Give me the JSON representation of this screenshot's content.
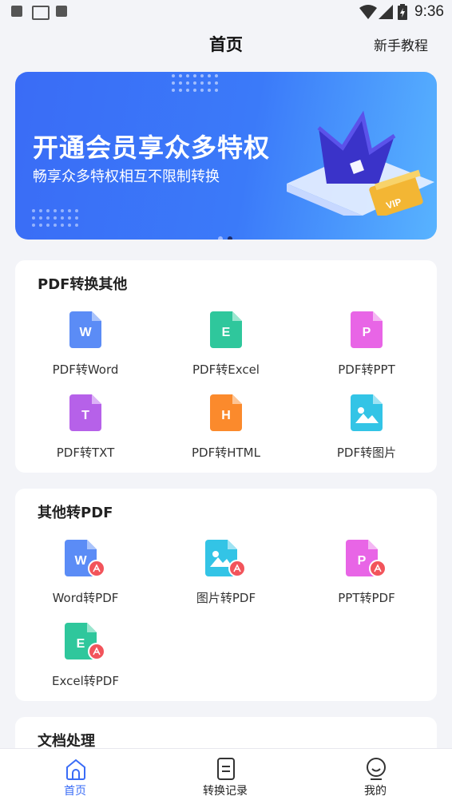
{
  "status_bar": {
    "time": "9:36"
  },
  "header": {
    "title": "首页",
    "tutorial_label": "新手教程"
  },
  "banner": {
    "title": "开通会员享众多特权",
    "subtitle": "畅享众多特权相互不限制转换",
    "badge": "VIP"
  },
  "sections": [
    {
      "title": "PDF转换其他",
      "items": [
        {
          "label": "PDF转Word",
          "glyph": "W",
          "color": "#5b8cf6"
        },
        {
          "label": "PDF转Excel",
          "glyph": "E",
          "color": "#2fc79c"
        },
        {
          "label": "PDF转PPT",
          "glyph": "P",
          "color": "#e865e6"
        },
        {
          "label": "PDF转TXT",
          "glyph": "T",
          "color": "#b661e9"
        },
        {
          "label": "PDF转HTML",
          "glyph": "H",
          "color": "#fb8a2c"
        },
        {
          "label": "PDF转图片",
          "glyph": "",
          "color": "#33c4e6"
        }
      ]
    },
    {
      "title": "其他转PDF",
      "items": [
        {
          "label": "Word转PDF",
          "glyph": "W",
          "color": "#5b8cf6"
        },
        {
          "label": "图片转PDF",
          "glyph": "",
          "color": "#33c4e6"
        },
        {
          "label": "PPT转PDF",
          "glyph": "P",
          "color": "#e865e6"
        },
        {
          "label": "Excel转PDF",
          "glyph": "E",
          "color": "#2fc79c"
        }
      ]
    },
    {
      "title": "文档处理"
    }
  ],
  "tabbar": [
    {
      "label": "首页",
      "icon": "home-icon",
      "active": true
    },
    {
      "label": "转换记录",
      "icon": "document-icon"
    },
    {
      "label": "我的",
      "icon": "profile-icon"
    }
  ],
  "colors": {
    "accent": "#3a6cf6",
    "pdf_badge": "#f2545b"
  }
}
